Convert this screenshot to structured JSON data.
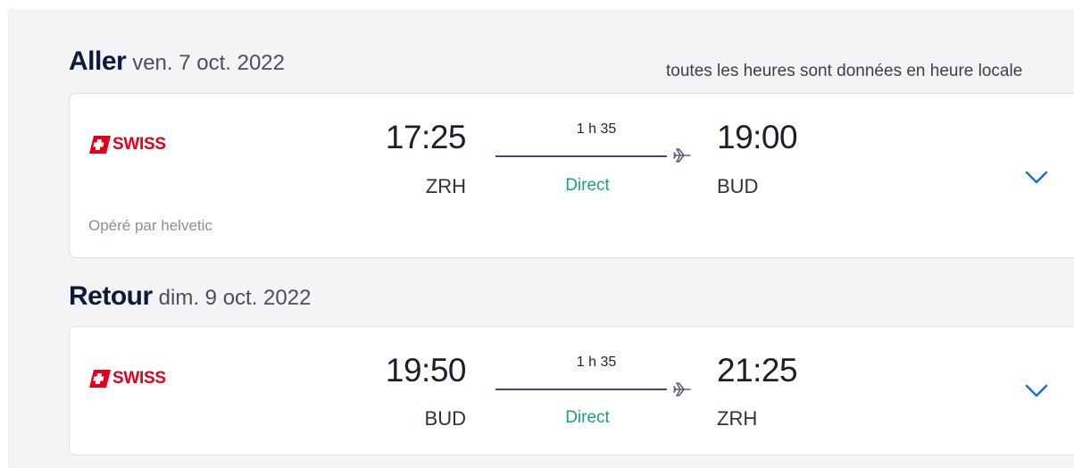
{
  "outbound": {
    "title": "Aller",
    "date": "ven. 7 oct. 2022",
    "timezone_note": "toutes les heures sont données en heure locale",
    "airline": "SWISS",
    "airline_icon": "swiss-cross-logo",
    "departure_time": "17:25",
    "departure_airport": "ZRH",
    "duration": "1 h 35",
    "stops": "Direct",
    "arrival_time": "19:00",
    "arrival_airport": "BUD",
    "operated_by": "Opéré par helvetic",
    "expand_icon": "chevron-down-icon"
  },
  "return": {
    "title": "Retour",
    "date": "dim. 9 oct. 2022",
    "airline": "SWISS",
    "airline_icon": "swiss-cross-logo",
    "departure_time": "19:50",
    "departure_airport": "BUD",
    "duration": "1 h 35",
    "stops": "Direct",
    "arrival_time": "21:25",
    "arrival_airport": "ZRH",
    "expand_icon": "chevron-down-icon"
  },
  "colors": {
    "brand_red": "#e2001a",
    "direct_green": "#17a37a",
    "chevron_blue": "#1e6fe0",
    "route_line": "#3e4a7a"
  }
}
